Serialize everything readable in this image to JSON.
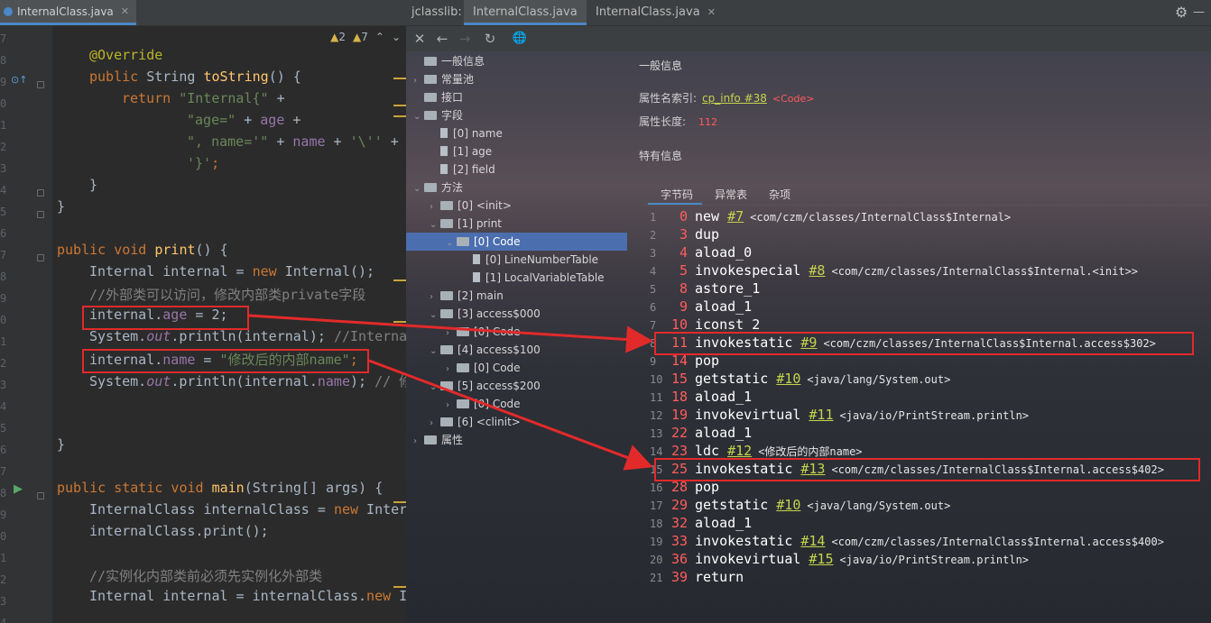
{
  "editor": {
    "tab_label": "InternalClass.java",
    "tab_close": "✕",
    "warnings_count": "2",
    "weak_warnings_count": "7",
    "gutter_line_numbers": [
      "7",
      "8",
      "9",
      "0",
      "1",
      "2",
      "3",
      "4",
      "5",
      "6",
      "7",
      "8",
      "9",
      "0",
      "1",
      "2",
      "3",
      "4",
      "5",
      "6",
      "7",
      "8",
      "9",
      "0",
      "1",
      "2",
      "3",
      "4"
    ],
    "code": {
      "l1_override": "@Override",
      "l2_public": "public",
      "l2_string": " String ",
      "l2_tostring": "toString",
      "l2_rest": "() {",
      "l3_return": "return",
      "l3_str": "\"Internal{\"",
      "l3_plus": " +",
      "l4_str": "\"age=\"",
      "l4_mid": " + ",
      "l4_fld": "age",
      "l4_plus": " +",
      "l5_str1": "\", name='\"",
      "l5_mid1": " + ",
      "l5_fld": "name",
      "l5_mid2": " + ",
      "l5_str2": "'\\''",
      "l5_plus": " +",
      "l6_str": "'}'",
      "l6_semi": ";",
      "l7_brace": "}",
      "l8_brace": "}",
      "l10_public": "public",
      "l10_void": " void ",
      "l10_print": "print",
      "l10_rest": "() {",
      "l11_a": "Internal internal = ",
      "l11_new": "new",
      "l11_b": " Internal();",
      "l12_comment": "//外部类可以访问，修改内部类private字段",
      "l13_a": "internal.",
      "l13_fld": "age",
      "l13_b": " = 2;",
      "l14_a": "System.",
      "l14_out": "out",
      "l14_b": ".println(internal); ",
      "l14_cm": "//Interna",
      "l15_a": "internal.",
      "l15_fld": "name",
      "l15_b": " = ",
      "l15_str": "\"修改后的内部name\"",
      "l15_c": ";",
      "l16_a": "System.",
      "l16_out": "out",
      "l16_b": ".println(internal.",
      "l16_fld": "name",
      "l16_c": "); ",
      "l16_cm": "// 修",
      "l19_brace": "}",
      "l21_kw": "public static void",
      "l21_main": "main",
      "l21_rest": "(String[] args) {",
      "l22_a": "InternalClass internalClass = ",
      "l22_new": "new",
      "l22_b": " Inter",
      "l23": "internalClass.print();",
      "l25_comment": "//实例化内部类前必须先实例化外部类",
      "l26_a": "Internal internal = internalClass.",
      "l26_new": "new",
      "l26_b": " I"
    }
  },
  "jclasslib": {
    "tabs": [
      "jclasslib:",
      "InternalClass.java",
      "InternalClass.java"
    ],
    "tab_close": "✕",
    "toolbar": {
      "close": "✕",
      "back": "←",
      "forward": "→",
      "refresh": "↻",
      "browser": "🌐"
    },
    "tree": [
      {
        "label": "一般信息",
        "arrow": ""
      },
      {
        "label": "常量池",
        "arrow": "›"
      },
      {
        "label": "接口",
        "arrow": ""
      },
      {
        "label": "字段",
        "arrow": "⌄"
      },
      {
        "label": "[0] name",
        "arrow": ""
      },
      {
        "label": "[1] age",
        "arrow": ""
      },
      {
        "label": "[2] field",
        "arrow": ""
      },
      {
        "label": "方法",
        "arrow": "⌄"
      },
      {
        "label": "[0] <init>",
        "arrow": "›"
      },
      {
        "label": "[1] print",
        "arrow": "⌄"
      },
      {
        "label": "[0] Code",
        "arrow": "⌄"
      },
      {
        "label": "[0] LineNumberTable",
        "arrow": ""
      },
      {
        "label": "[1] LocalVariableTable",
        "arrow": ""
      },
      {
        "label": "[2] main",
        "arrow": "›"
      },
      {
        "label": "[3] access$000",
        "arrow": "⌄"
      },
      {
        "label": "[0] Code",
        "arrow": "›"
      },
      {
        "label": "[4] access$100",
        "arrow": "⌄"
      },
      {
        "label": "[0] Code",
        "arrow": "›"
      },
      {
        "label": "[5] access$200",
        "arrow": "⌄"
      },
      {
        "label": "[0] Code",
        "arrow": "›"
      },
      {
        "label": "[6] <clinit>",
        "arrow": "›"
      },
      {
        "label": "属性",
        "arrow": "›"
      }
    ],
    "general_title": "一般信息",
    "attr_name_label": "属性名索引:",
    "attr_name_link": "cp_info #38",
    "attr_name_value": "<Code>",
    "attr_length_label": "属性长度:",
    "attr_length_value": "112",
    "specific_title": "特有信息",
    "subtabs": [
      "字节码",
      "异常表",
      "杂项"
    ],
    "bytecode": [
      {
        "line": "1",
        "offset": "0",
        "op": "new",
        "ref": "#7",
        "comment": "<com/czm/classes/InternalClass$Internal>"
      },
      {
        "line": "2",
        "offset": "3",
        "op": "dup",
        "ref": "",
        "comment": ""
      },
      {
        "line": "3",
        "offset": "4",
        "op": "aload_0",
        "ref": "",
        "comment": ""
      },
      {
        "line": "4",
        "offset": "5",
        "op": "invokespecial",
        "ref": "#8",
        "comment": "<com/czm/classes/InternalClass$Internal.<init>>"
      },
      {
        "line": "5",
        "offset": "8",
        "op": "astore_1",
        "ref": "",
        "comment": ""
      },
      {
        "line": "6",
        "offset": "9",
        "op": "aload_1",
        "ref": "",
        "comment": ""
      },
      {
        "line": "7",
        "offset": "10",
        "op": "iconst_2",
        "ref": "",
        "comment": ""
      },
      {
        "line": "8",
        "offset": "11",
        "op": "invokestatic",
        "ref": "#9",
        "comment": "<com/czm/classes/InternalClass$Internal.access$302>"
      },
      {
        "line": "9",
        "offset": "14",
        "op": "pop",
        "ref": "",
        "comment": ""
      },
      {
        "line": "10",
        "offset": "15",
        "op": "getstatic",
        "ref": "#10",
        "comment": "<java/lang/System.out>"
      },
      {
        "line": "11",
        "offset": "18",
        "op": "aload_1",
        "ref": "",
        "comment": ""
      },
      {
        "line": "12",
        "offset": "19",
        "op": "invokevirtual",
        "ref": "#11",
        "comment": "<java/io/PrintStream.println>"
      },
      {
        "line": "13",
        "offset": "22",
        "op": "aload_1",
        "ref": "",
        "comment": ""
      },
      {
        "line": "14",
        "offset": "23",
        "op": "ldc",
        "ref": "#12",
        "comment": "<修改后的内部name>"
      },
      {
        "line": "15",
        "offset": "25",
        "op": "invokestatic",
        "ref": "#13",
        "comment": "<com/czm/classes/InternalClass$Internal.access$402>"
      },
      {
        "line": "16",
        "offset": "28",
        "op": "pop",
        "ref": "",
        "comment": ""
      },
      {
        "line": "17",
        "offset": "29",
        "op": "getstatic",
        "ref": "#10",
        "comment": "<java/lang/System.out>"
      },
      {
        "line": "18",
        "offset": "32",
        "op": "aload_1",
        "ref": "",
        "comment": ""
      },
      {
        "line": "19",
        "offset": "33",
        "op": "invokestatic",
        "ref": "#14",
        "comment": "<com/czm/classes/InternalClass$Internal.access$400>"
      },
      {
        "line": "20",
        "offset": "36",
        "op": "invokevirtual",
        "ref": "#15",
        "comment": "<java/io/PrintStream.println>"
      },
      {
        "line": "21",
        "offset": "39",
        "op": "return",
        "ref": "",
        "comment": ""
      }
    ]
  },
  "colors": {
    "accent": "#4a88c7",
    "highlight_box": "#e22a2a",
    "bytecode_offset": "#ff5d5d",
    "ref_link": "#c5d44c"
  }
}
